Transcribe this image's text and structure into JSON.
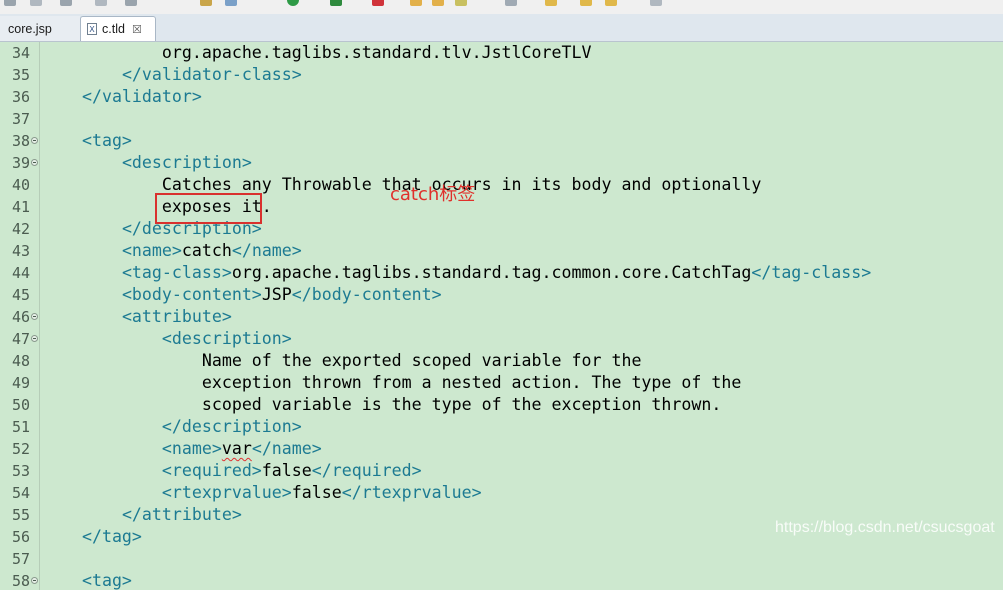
{
  "tabs": [
    {
      "label": "core.jsp",
      "active": false
    },
    {
      "label": "c.tld",
      "active": true,
      "icon": "xml-file-icon",
      "close": "☒"
    }
  ],
  "editor": {
    "background": "#cde8cf",
    "tag_color": "#1c7a92",
    "lines": [
      {
        "n": "34",
        "fold": false,
        "indent": "            ",
        "parts": [
          {
            "t": "txt",
            "s": "org.apache.taglibs.standard.tlv.JstlCoreTLV"
          }
        ]
      },
      {
        "n": "35",
        "fold": false,
        "indent": "        ",
        "parts": [
          {
            "t": "tag",
            "s": "</validator-class>"
          }
        ]
      },
      {
        "n": "36",
        "fold": false,
        "indent": "    ",
        "parts": [
          {
            "t": "tag",
            "s": "</validator>"
          }
        ]
      },
      {
        "n": "37",
        "fold": false,
        "indent": "",
        "parts": []
      },
      {
        "n": "38",
        "fold": true,
        "indent": "    ",
        "parts": [
          {
            "t": "tag",
            "s": "<tag>"
          }
        ]
      },
      {
        "n": "39",
        "fold": true,
        "indent": "        ",
        "parts": [
          {
            "t": "tag",
            "s": "<description>"
          }
        ]
      },
      {
        "n": "40",
        "fold": false,
        "indent": "            ",
        "parts": [
          {
            "t": "txt",
            "s": "Catches any Throwable that occurs in its body and optionally"
          }
        ]
      },
      {
        "n": "41",
        "fold": false,
        "indent": "            ",
        "parts": [
          {
            "t": "txt",
            "s": "exposes it."
          }
        ]
      },
      {
        "n": "42",
        "fold": false,
        "indent": "        ",
        "parts": [
          {
            "t": "tag",
            "s": "</description>"
          }
        ]
      },
      {
        "n": "43",
        "fold": false,
        "indent": "        ",
        "parts": [
          {
            "t": "tag",
            "s": "<name>"
          },
          {
            "t": "txt",
            "s": "catch"
          },
          {
            "t": "tag",
            "s": "</name>"
          }
        ]
      },
      {
        "n": "44",
        "fold": false,
        "indent": "        ",
        "parts": [
          {
            "t": "tag",
            "s": "<tag-class>"
          },
          {
            "t": "txt",
            "s": "org.apache.taglibs.standard.tag.common.core.CatchTag"
          },
          {
            "t": "tag",
            "s": "</tag-class>"
          }
        ]
      },
      {
        "n": "45",
        "fold": false,
        "indent": "        ",
        "parts": [
          {
            "t": "tag",
            "s": "<body-content>"
          },
          {
            "t": "txt",
            "s": "JSP"
          },
          {
            "t": "tag",
            "s": "</body-content>"
          }
        ]
      },
      {
        "n": "46",
        "fold": true,
        "indent": "        ",
        "parts": [
          {
            "t": "tag",
            "s": "<attribute>"
          }
        ]
      },
      {
        "n": "47",
        "fold": true,
        "indent": "            ",
        "parts": [
          {
            "t": "tag",
            "s": "<description>"
          }
        ]
      },
      {
        "n": "48",
        "fold": false,
        "indent": "                ",
        "parts": [
          {
            "t": "txt",
            "s": "Name of the exported scoped variable for the"
          }
        ]
      },
      {
        "n": "49",
        "fold": false,
        "indent": "                ",
        "parts": [
          {
            "t": "txt",
            "s": "exception thrown from a nested action. The type of the"
          }
        ]
      },
      {
        "n": "50",
        "fold": false,
        "indent": "                ",
        "parts": [
          {
            "t": "txt",
            "s": "scoped variable is the type of the exception thrown."
          }
        ]
      },
      {
        "n": "51",
        "fold": false,
        "indent": "            ",
        "parts": [
          {
            "t": "tag",
            "s": "</description>"
          }
        ]
      },
      {
        "n": "52",
        "fold": false,
        "indent": "            ",
        "parts": [
          {
            "t": "tag",
            "s": "<name>"
          },
          {
            "t": "sq",
            "s": "var"
          },
          {
            "t": "tag",
            "s": "</name>"
          }
        ]
      },
      {
        "n": "53",
        "fold": false,
        "indent": "            ",
        "parts": [
          {
            "t": "tag",
            "s": "<required>"
          },
          {
            "t": "txt",
            "s": "false"
          },
          {
            "t": "tag",
            "s": "</required>"
          }
        ]
      },
      {
        "n": "54",
        "fold": false,
        "indent": "            ",
        "parts": [
          {
            "t": "tag",
            "s": "<rtexprvalue>"
          },
          {
            "t": "txt",
            "s": "false"
          },
          {
            "t": "tag",
            "s": "</rtexprvalue>"
          }
        ]
      },
      {
        "n": "55",
        "fold": false,
        "indent": "        ",
        "parts": [
          {
            "t": "tag",
            "s": "</attribute>"
          }
        ]
      },
      {
        "n": "56",
        "fold": false,
        "indent": "    ",
        "parts": [
          {
            "t": "tag",
            "s": "</tag>"
          }
        ]
      },
      {
        "n": "57",
        "fold": false,
        "indent": "",
        "parts": []
      },
      {
        "n": "58",
        "fold": true,
        "indent": "    ",
        "parts": [
          {
            "t": "tag",
            "s": "<tag>"
          }
        ]
      }
    ]
  },
  "annotation": {
    "label": "catch标签",
    "color": "#e0302b"
  },
  "watermark": "https://blog.csdn.net/csucsgoat"
}
